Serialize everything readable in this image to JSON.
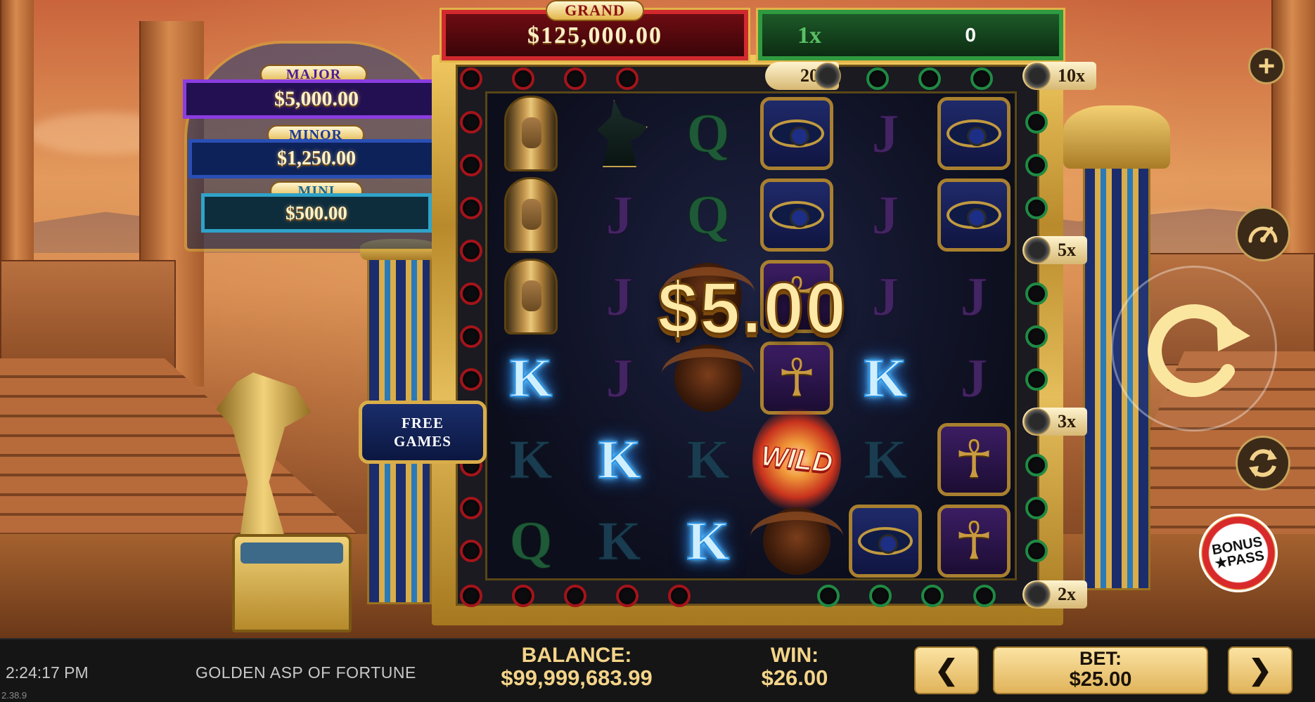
{
  "jackpots": {
    "grand_label": "GRAND",
    "grand_value": "$125,000.00",
    "major_label": "MAJOR",
    "major_value": "$5,000.00",
    "minor_label": "MINOR",
    "minor_value": "$1,250.00",
    "mini_label": "MINI",
    "mini_value": "$500.00"
  },
  "multiplier_bar": {
    "left": "1x",
    "right": "0"
  },
  "multiplier_tags": [
    "20x",
    "10x",
    "5x",
    "3x",
    "2x"
  ],
  "reels": {
    "win_amount": "$5.00",
    "wild_label": "WILD",
    "letters": {
      "q": "Q",
      "j": "J",
      "k": "K"
    },
    "ankh_glyph": "☥"
  },
  "free_games_label": "FREE\nGAMES",
  "controls": {
    "plus_glyph": "+",
    "spin_glyph": "↻",
    "auto_glyph": "⟳",
    "bonus_pass_line1": "BONUS",
    "bonus_pass_line2": "★PASS"
  },
  "bottom_bar": {
    "time": "2:24:17 PM",
    "version": "2.38.9",
    "game_title": "GOLDEN ASP OF FORTUNE",
    "balance_label": "BALANCE:",
    "balance_value": "$99,999,683.99",
    "win_label": "WIN:",
    "win_value": "$26.00",
    "bet_label": "BET:",
    "bet_value": "$25.00",
    "bet_decrease_glyph": "❮",
    "bet_increase_glyph": "❯"
  },
  "colors": {
    "accent_gold": "#f4d489",
    "grand_red": "#d12a2e",
    "multiplier_green": "#2f9a3f",
    "major_purple": "#8b3de0",
    "minor_blue": "#2a4fb6",
    "mini_teal": "#2fa3c9"
  }
}
